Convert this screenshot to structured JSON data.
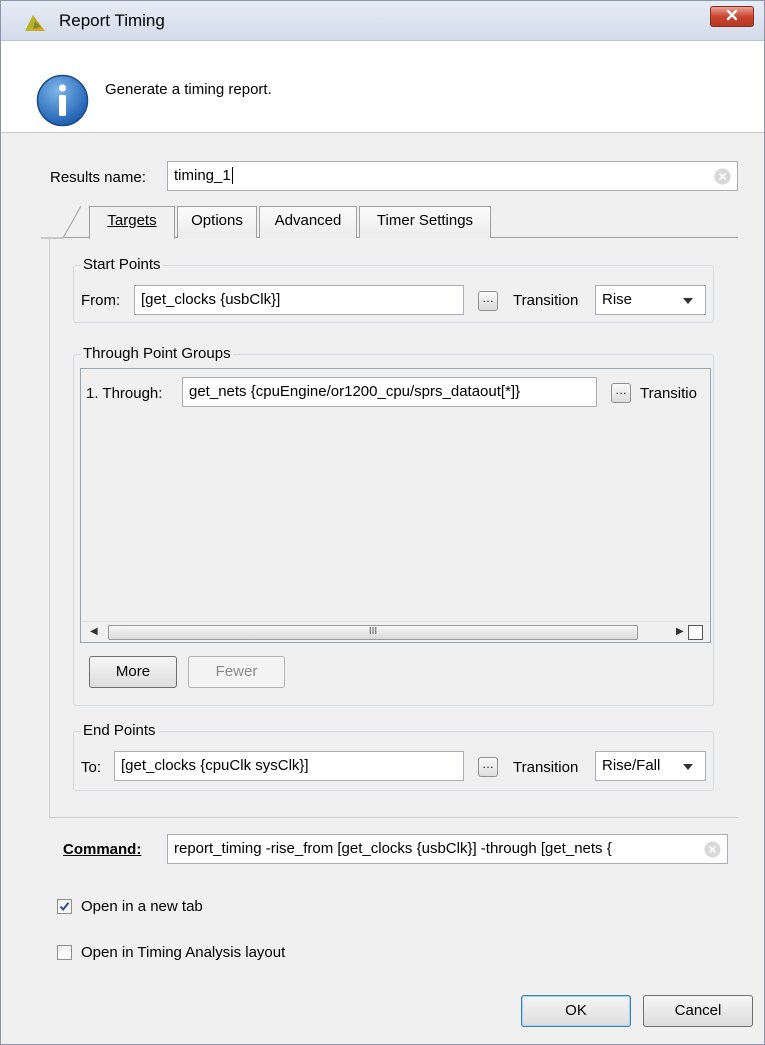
{
  "window": {
    "title": "Report Timing",
    "header_text": "Generate a timing report."
  },
  "results": {
    "label": "Results name:",
    "value": "timing_1"
  },
  "tabs": [
    {
      "label": "Targets",
      "active": true
    },
    {
      "label": "Options",
      "active": false
    },
    {
      "label": "Advanced",
      "active": false
    },
    {
      "label": "Timer Settings",
      "active": false
    }
  ],
  "start_points": {
    "title": "Start Points",
    "from_label": "From:",
    "from_value": "[get_clocks {usbClk}]",
    "transition_label": "Transition",
    "transition_value": "Rise"
  },
  "through": {
    "title": "Through Point Groups",
    "row_label": "1. Through:",
    "row_value": "get_nets {cpuEngine/or1200_cpu/sprs_dataout[*]}",
    "transition_label": "Transitio",
    "scroll_grip": "III",
    "more_label": "More",
    "fewer_label": "Fewer"
  },
  "end_points": {
    "title": "End Points",
    "to_label": "To:",
    "to_value": "[get_clocks {cpuClk sysClk}]",
    "transition_label": "Transition",
    "transition_value": "Rise/Fall"
  },
  "command": {
    "label": "Command:",
    "value": "report_timing -rise_from [get_clocks {usbClk}] -through  [get_nets {"
  },
  "options": {
    "new_tab_label": "Open in a new tab",
    "new_tab_checked": true,
    "timing_layout_label": "Open in Timing Analysis layout",
    "timing_layout_checked": false
  },
  "buttons": {
    "ok": "OK",
    "cancel": "Cancel"
  },
  "icons": {
    "app": "vivado-logo-icon",
    "info": "info-icon",
    "close": "close-icon",
    "clear": "clear-icon"
  }
}
